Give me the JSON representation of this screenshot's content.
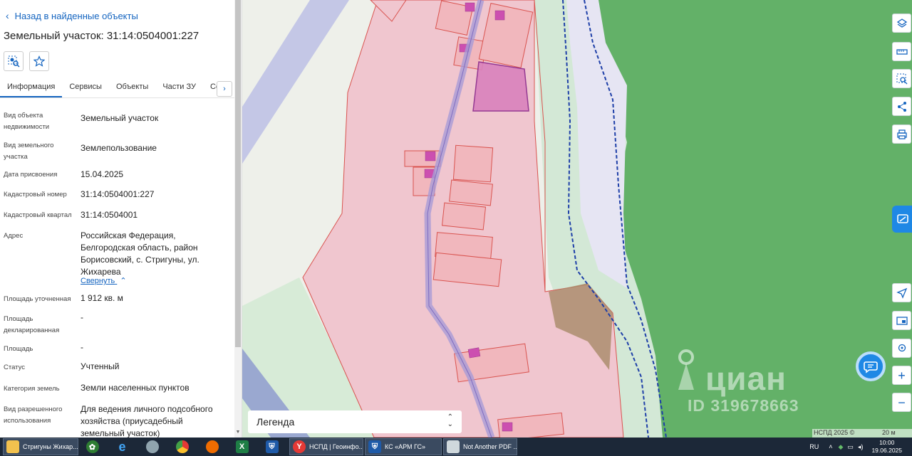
{
  "panel": {
    "back_label": "Назад в найденные объекты",
    "title": "Земельный участок: 31:14:0504001:227",
    "tabs": [
      "Информация",
      "Сервисы",
      "Объекты",
      "Части ЗУ",
      "Соста"
    ],
    "active_tab": "Информация",
    "rows": [
      {
        "label": "Вид объекта недвижимости",
        "value": "Земельный участок"
      },
      {
        "label": "Вид земельного участка",
        "value": "Землепользование"
      },
      {
        "label": "Дата присвоения",
        "value": "15.04.2025"
      },
      {
        "label": "Кадастровый номер",
        "value": "31:14:0504001:227"
      },
      {
        "label": "Кадастровый квартал",
        "value": "31:14:0504001"
      },
      {
        "label": "Адрес",
        "value": "Российская Федерация, Белгородская область, район Борисовский, с. Стригуны, ул. Жихарева"
      },
      {
        "label": "Площадь уточненная",
        "value": "1 912 кв. м"
      },
      {
        "label": "Площадь декларированная",
        "value": "-"
      },
      {
        "label": "Площадь",
        "value": "-"
      },
      {
        "label": "Статус",
        "value": "Учтенный"
      },
      {
        "label": "Категория земель",
        "value": "Земли населенных пунктов"
      },
      {
        "label": "Вид разрешенного использования",
        "value": "Для ведения личного подсобного хозяйства (приусадебный земельный участок)"
      }
    ],
    "collapse_label": "Свернуть"
  },
  "map": {
    "legend_label": "Легенда",
    "watermark_brand": "циан",
    "watermark_id": "ID 319678663",
    "scale_copyright": "НСПД 2025 ©",
    "scale_distance": "20 м"
  },
  "taskbar": {
    "items": [
      {
        "label": "Стригуны Жихар...",
        "icon": "folder-icon"
      },
      {
        "label": "НСПД | Геоинфо...",
        "icon": "yandex-browser-icon"
      },
      {
        "label": "КС «АРМ ГС»",
        "icon": "gov-emblem-icon"
      },
      {
        "label": "Not Another PDF ...",
        "icon": "pdf-scanner-icon"
      }
    ],
    "language": "RU",
    "time": "10:00",
    "date": "19.06.2025"
  }
}
